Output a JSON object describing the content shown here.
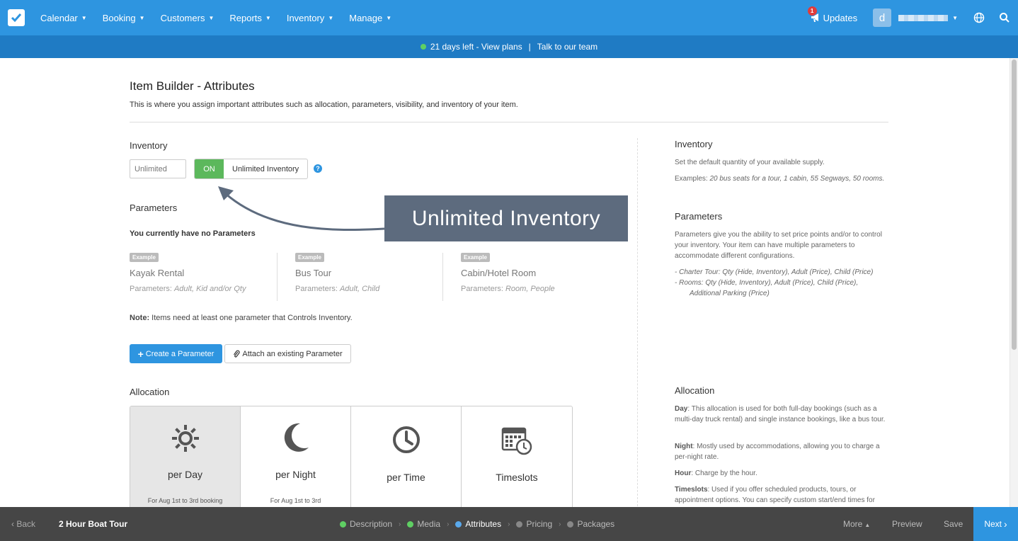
{
  "nav": {
    "menu": [
      {
        "label": "Calendar"
      },
      {
        "label": "Booking"
      },
      {
        "label": "Customers"
      },
      {
        "label": "Reports"
      },
      {
        "label": "Inventory"
      },
      {
        "label": "Manage"
      }
    ],
    "updates_label": "Updates",
    "updates_count": "1",
    "avatar_letter": "d"
  },
  "trial": {
    "days_left": "21 days left - View plans",
    "talk": "Talk to our team"
  },
  "page": {
    "title": "Item Builder - Attributes",
    "description": "This is where you assign important attributes such as allocation, parameters, visibility, and inventory of your item."
  },
  "inventory": {
    "label": "Inventory",
    "placeholder": "Unlimited",
    "toggle_on": "ON",
    "toggle_label": "Unlimited Inventory",
    "help": "?"
  },
  "parameters": {
    "label": "Parameters",
    "empty": "You currently have no Parameters",
    "examples": [
      {
        "badge": "Example",
        "title": "Kayak Rental",
        "prefix": "Parameters: ",
        "params": "Adult, Kid and/or Qty"
      },
      {
        "badge": "Example",
        "title": "Bus Tour",
        "prefix": "Parameters: ",
        "params": "Adult, Child"
      },
      {
        "badge": "Example",
        "title": "Cabin/Hotel Room",
        "prefix": "Parameters: ",
        "params": "Room, People"
      }
    ],
    "note_label": "Note:",
    "note": " Items need at least one parameter that Controls Inventory.",
    "create_button": "Create a Parameter",
    "attach_button": "Attach an existing Parameter"
  },
  "allocation": {
    "label": "Allocation",
    "cards": [
      {
        "label": "per Day",
        "icon": "sun-icon",
        "sub": "For Aug 1st to 3rd booking"
      },
      {
        "label": "per Night",
        "icon": "moon-icon",
        "sub": "For Aug 1st to 3rd"
      },
      {
        "label": "per Time",
        "icon": "clock-icon"
      },
      {
        "label": "Timeslots",
        "icon": "calendar-clock-icon"
      }
    ]
  },
  "side": {
    "inventory_title": "Inventory",
    "inventory_desc": "Set the default quantity of your available supply.",
    "inventory_examples_prefix": "Examples: ",
    "inventory_examples": "20 bus seats for a tour, 1 cabin, 55 Segways, 50 rooms.",
    "parameters_title": "Parameters",
    "parameters_desc": "Parameters give you the ability to set price points and/or to control your inventory. Your item can have multiple parameters to accommodate different configurations.",
    "parameters_ex1": "- Charter Tour: Qty (Hide, Inventory), Adult (Price), Child (Price)",
    "parameters_ex2": "- Rooms: Qty (Hide, Inventory), Adult (Price), Child (Price),",
    "parameters_ex2b": "Additional Parking (Price)",
    "allocation_title": "Allocation",
    "day_label": "Day",
    "day_desc": ": This allocation is used for both full-day bookings (such as a multi-day truck rental) and single instance bookings, like a bus tour.",
    "night_label": "Night",
    "night_desc": ": Mostly used by accommodations, allowing you to charge a per-night rate.",
    "hour_label": "Hour",
    "hour_desc": ": Charge by the hour.",
    "timeslots_label": "Timeslots",
    "timeslots_desc": ": Used if you offer scheduled products, tours, or appointment options. You can specify custom start/end times for"
  },
  "callout": {
    "text": "Unlimited Inventory"
  },
  "bottom": {
    "back": "Back",
    "item_name": "2 Hour Boat Tour",
    "steps": [
      {
        "label": "Description",
        "color": "#5fcf63"
      },
      {
        "label": "Media",
        "color": "#5fcf63"
      },
      {
        "label": "Attributes",
        "color": "#5aa9ec"
      },
      {
        "label": "Pricing",
        "color": "#888888"
      },
      {
        "label": "Packages",
        "color": "#888888"
      }
    ],
    "more": "More",
    "preview": "Preview",
    "save": "Save",
    "next": "Next"
  }
}
